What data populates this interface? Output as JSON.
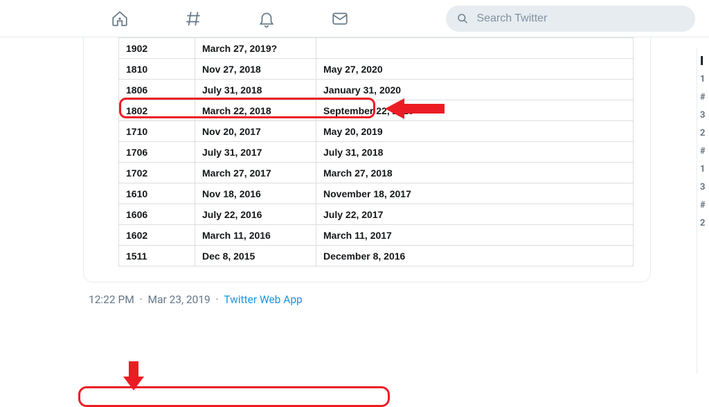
{
  "search": {
    "placeholder": "Search Twitter"
  },
  "table": {
    "rows": [
      {
        "code": "1902",
        "date1": "March 27, 2019?",
        "date2": ""
      },
      {
        "code": "1810",
        "date1": "Nov 27, 2018",
        "date2": "May 27, 2020"
      },
      {
        "code": "1806",
        "date1": "July 31, 2018",
        "date2": "January 31, 2020"
      },
      {
        "code": "1802",
        "date1": "March 22, 2018",
        "date2": "September 22, 2019"
      },
      {
        "code": "1710",
        "date1": "Nov 20, 2017",
        "date2": "May 20, 2019"
      },
      {
        "code": "1706",
        "date1": "July 31, 2017",
        "date2": "July 31, 2018"
      },
      {
        "code": "1702",
        "date1": "March 27, 2017",
        "date2": "March 27, 2018"
      },
      {
        "code": "1610",
        "date1": "Nov 18, 2016",
        "date2": "November 18, 2017"
      },
      {
        "code": "1606",
        "date1": "July 22, 2016",
        "date2": "July 22, 2017"
      },
      {
        "code": "1602",
        "date1": "March 11, 2016",
        "date2": "March 11, 2017"
      },
      {
        "code": "1511",
        "date1": "Dec 8, 2015",
        "date2": "December 8, 2016"
      }
    ]
  },
  "meta": {
    "time": "12:22 PM",
    "date": "Mar 23, 2019",
    "app": "Twitter Web App"
  },
  "sidebar": {
    "header": "I",
    "frags": [
      "1",
      "#",
      "3",
      "2",
      "#",
      "1",
      "3",
      "#",
      "2"
    ]
  }
}
